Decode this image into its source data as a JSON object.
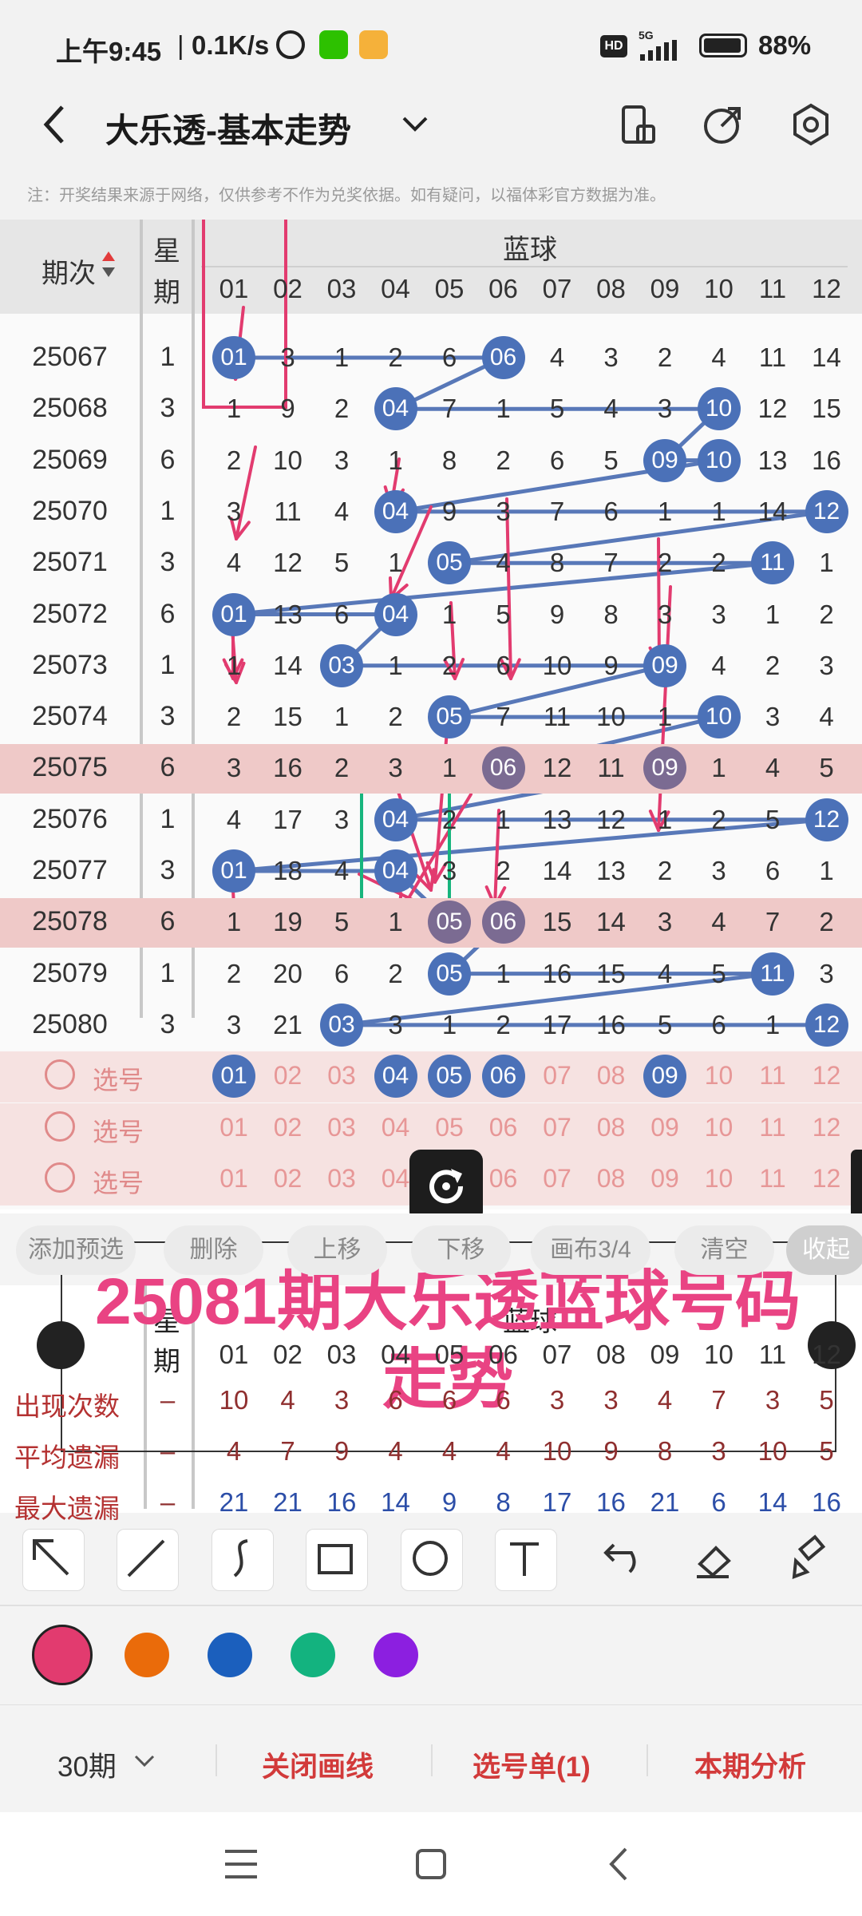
{
  "status": {
    "time": "上午9:45",
    "speed": "0.1K/s",
    "battery": "88%",
    "hd": "HD",
    "network": "5G"
  },
  "header": {
    "title": "大乐透-基本走势",
    "note": "注：开奖结果来源于网络，仅供参考不作为兑奖依据。如有疑问，以福体彩官方数据为准。"
  },
  "table": {
    "col_period": "期次",
    "col_week_top": "星",
    "col_week_bottom": "期",
    "blue_ball": "蓝球",
    "columns": [
      "01",
      "02",
      "03",
      "04",
      "05",
      "06",
      "07",
      "08",
      "09",
      "10",
      "11",
      "12"
    ],
    "rows": [
      {
        "period": "25067",
        "week": "1",
        "cells": [
          "01",
          "3",
          "1",
          "2",
          "6",
          "06",
          "4",
          "3",
          "2",
          "4",
          "11",
          "14"
        ],
        "hits": [
          0,
          5
        ]
      },
      {
        "period": "25068",
        "week": "3",
        "cells": [
          "1",
          "9",
          "2",
          "04",
          "7",
          "1",
          "5",
          "4",
          "3",
          "10",
          "12",
          "15"
        ],
        "hits": [
          3,
          9
        ]
      },
      {
        "period": "25069",
        "week": "6",
        "cells": [
          "2",
          "10",
          "3",
          "1",
          "8",
          "2",
          "6",
          "5",
          "09",
          "10",
          "13",
          "16"
        ],
        "hits": [
          8,
          9
        ]
      },
      {
        "period": "25070",
        "week": "1",
        "cells": [
          "3",
          "11",
          "4",
          "04",
          "9",
          "3",
          "7",
          "6",
          "1",
          "1",
          "14",
          "12"
        ],
        "hits": [
          3,
          11
        ]
      },
      {
        "period": "25071",
        "week": "3",
        "cells": [
          "4",
          "12",
          "5",
          "1",
          "05",
          "4",
          "8",
          "7",
          "2",
          "2",
          "11",
          "1"
        ],
        "hits": [
          4,
          10
        ]
      },
      {
        "period": "25072",
        "week": "6",
        "cells": [
          "01",
          "13",
          "6",
          "04",
          "1",
          "5",
          "9",
          "8",
          "3",
          "3",
          "1",
          "2"
        ],
        "hits": [
          0,
          3
        ]
      },
      {
        "period": "25073",
        "week": "1",
        "cells": [
          "1",
          "14",
          "03",
          "1",
          "2",
          "6",
          "10",
          "9",
          "09",
          "4",
          "2",
          "3"
        ],
        "hits": [
          2,
          8
        ]
      },
      {
        "period": "25074",
        "week": "3",
        "cells": [
          "2",
          "15",
          "1",
          "2",
          "05",
          "7",
          "11",
          "10",
          "1",
          "10",
          "3",
          "4"
        ],
        "hits": [
          4,
          9
        ]
      },
      {
        "period": "25075",
        "week": "6",
        "cells": [
          "3",
          "16",
          "2",
          "3",
          "1",
          "06",
          "12",
          "11",
          "09",
          "1",
          "4",
          "5"
        ],
        "hits": [
          5,
          8
        ],
        "highlight": true
      },
      {
        "period": "25076",
        "week": "1",
        "cells": [
          "4",
          "17",
          "3",
          "04",
          "2",
          "1",
          "13",
          "12",
          "1",
          "2",
          "5",
          "12"
        ],
        "hits": [
          3,
          11
        ]
      },
      {
        "period": "25077",
        "week": "3",
        "cells": [
          "01",
          "18",
          "4",
          "04",
          "3",
          "2",
          "14",
          "13",
          "2",
          "3",
          "6",
          "1"
        ],
        "hits": [
          0,
          3
        ]
      },
      {
        "period": "25078",
        "week": "6",
        "cells": [
          "1",
          "19",
          "5",
          "1",
          "05",
          "06",
          "15",
          "14",
          "3",
          "4",
          "7",
          "2"
        ],
        "hits": [
          4,
          5
        ],
        "highlight": true
      },
      {
        "period": "25079",
        "week": "1",
        "cells": [
          "2",
          "20",
          "6",
          "2",
          "05",
          "1",
          "16",
          "15",
          "4",
          "5",
          "11",
          "3"
        ],
        "hits": [
          4,
          10
        ]
      },
      {
        "period": "25080",
        "week": "3",
        "cells": [
          "3",
          "21",
          "03",
          "3",
          "1",
          "2",
          "17",
          "16",
          "5",
          "6",
          "1",
          "12"
        ],
        "hits": [
          2,
          11
        ]
      }
    ],
    "picked": [
      "01",
      "04",
      "05",
      "06",
      "09"
    ],
    "pick_label": "选号",
    "pick_rows": 3
  },
  "actions": [
    "添加预选",
    "删除",
    "上移",
    "下移",
    "画布3/4",
    "清空",
    "收起"
  ],
  "overlay_text": "25081期大乐透蓝球号码走势",
  "stats": {
    "week_top": "星",
    "week_bottom": "期",
    "blue_ball": "蓝球",
    "rows": [
      {
        "label": "出现次数",
        "dash": "–",
        "values": [
          "10",
          "4",
          "3",
          "6",
          "6",
          "6",
          "3",
          "3",
          "4",
          "7",
          "3",
          "5"
        ]
      },
      {
        "label": "平均遗漏",
        "dash": "–",
        "values": [
          "4",
          "7",
          "9",
          "4",
          "4",
          "4",
          "10",
          "9",
          "8",
          "3",
          "10",
          "5"
        ]
      },
      {
        "label": "最大遗漏",
        "dash": "–",
        "values": [
          "21",
          "21",
          "16",
          "14",
          "9",
          "8",
          "17",
          "16",
          "21",
          "6",
          "14",
          "16"
        ]
      }
    ]
  },
  "tools": [
    "arrow-tool-icon",
    "line-tool-icon",
    "curve-tool-icon",
    "rect-tool-icon",
    "circle-tool-icon",
    "text-tool-icon",
    "undo-icon",
    "eraser-icon",
    "clear-all-icon"
  ],
  "colors": [
    "#e23b6f",
    "#ea6b0a",
    "#1b5fbd",
    "#13b37f",
    "#8c1fe0"
  ],
  "bottom": {
    "periods": "30期",
    "close_lines": "关闭画线",
    "pick_list": "选号单(1)",
    "analysis": "本期分析"
  }
}
